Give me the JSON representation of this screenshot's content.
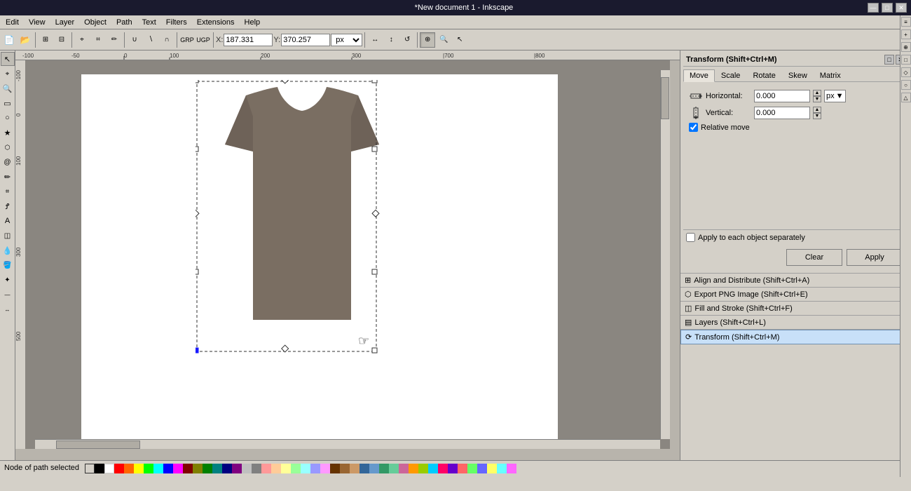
{
  "titleBar": {
    "title": "*New document 1 - Inkscape",
    "minBtn": "—",
    "maxBtn": "□",
    "closeBtn": "✕"
  },
  "menuBar": {
    "items": [
      "Edit",
      "View",
      "Layer",
      "Object",
      "Path",
      "Text",
      "Filters",
      "Extensions",
      "Help"
    ]
  },
  "coordsBar": {
    "xLabel": "X:",
    "xValue": "187.331",
    "yLabel": "Y:",
    "yValue": "370.257",
    "unit": "px"
  },
  "transformPanel": {
    "title": "Transform (Shift+Ctrl+M)",
    "tabs": [
      "Move",
      "Scale",
      "Rotate",
      "Skew",
      "Matrix"
    ],
    "activeTab": "Move",
    "horizontalLabel": "Horizontal:",
    "horizontalValue": "0.000",
    "verticalLabel": "Vertical:",
    "verticalValue": "0.000",
    "relativeMove": "Relative move",
    "applyEach": "Apply to each object separately",
    "clearBtn": "Clear",
    "applyBtn": "Apply",
    "unit": "px"
  },
  "collapsedPanels": [
    {
      "title": "Align and Distribute (Shift+Ctrl+A)",
      "active": false
    },
    {
      "title": "Export PNG Image (Shift+Ctrl+E)",
      "active": false
    },
    {
      "title": "Fill and Stroke (Shift+Ctrl+F)",
      "active": false
    },
    {
      "title": "Layers (Shift+Ctrl+L)",
      "active": false
    },
    {
      "title": "Transform (Shift+Ctrl+M)",
      "active": true
    }
  ],
  "statusBar": {
    "text": "Node of path selected"
  },
  "colors": {
    "tshirt": "#7a6e62",
    "background": "#8a8680",
    "page": "#ffffff",
    "selectionDash": "#333333",
    "activePanel": "#c8e0f8"
  }
}
